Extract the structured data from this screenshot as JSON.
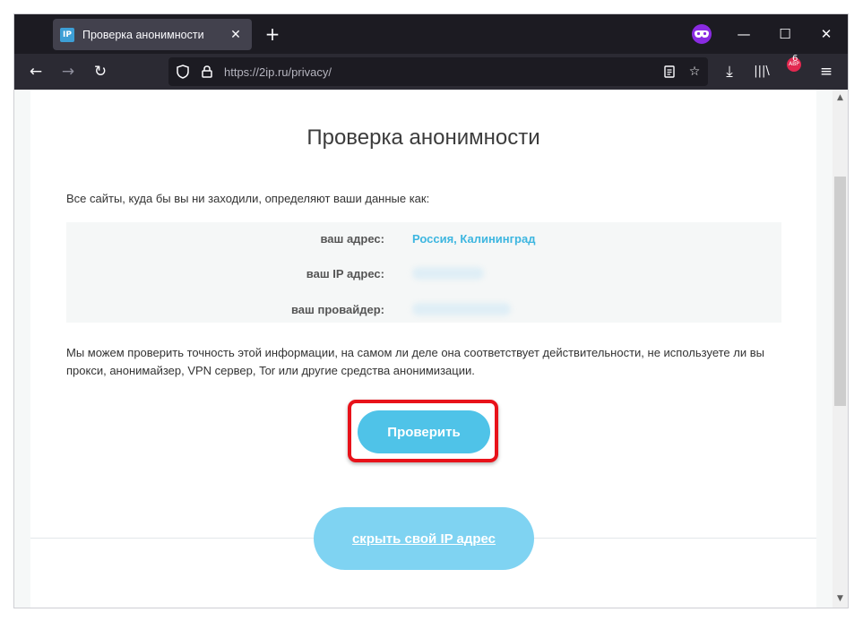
{
  "browser": {
    "tab": {
      "favicon_text": "IP",
      "title": "Проверка анонимности",
      "close_glyph": "✕"
    },
    "new_tab_glyph": "+",
    "window_controls": {
      "minimize": "—",
      "maximize": "☐",
      "close": "✕"
    },
    "url": "https://2ip.ru/privacy/",
    "toolbar_badge": "ABP",
    "toolbar_badge_count": "6",
    "icons": [
      "back-arrow-icon",
      "forward-arrow-icon",
      "reload-icon",
      "shield-icon",
      "lock-icon",
      "reader-view-icon",
      "bookmark-star-icon",
      "download-icon",
      "library-icon",
      "adblock-icon",
      "menu-icon",
      "private-mask-icon"
    ]
  },
  "page": {
    "title": "Проверка анонимности",
    "intro": "Все сайты, куда бы вы ни заходили, определяют ваши данные как:",
    "info": {
      "address_label": "ваш адрес:",
      "address_value": "Россия, Калининград",
      "ip_label": "ваш IP адрес:",
      "provider_label": "ваш провайдер:"
    },
    "description": "Мы можем проверить точность этой информации, на самом ли деле она соответствует действительности, не используете ли вы прокси, анонимайзер, VPN сервер, Tor или другие средства анонимизации.",
    "check_button": "Проверить",
    "hide_ip_button": "скрыть свой IP адрес"
  },
  "colors": {
    "accent": "#4fc3e8",
    "highlight": "#e8121a",
    "link": "#3db6e0"
  }
}
